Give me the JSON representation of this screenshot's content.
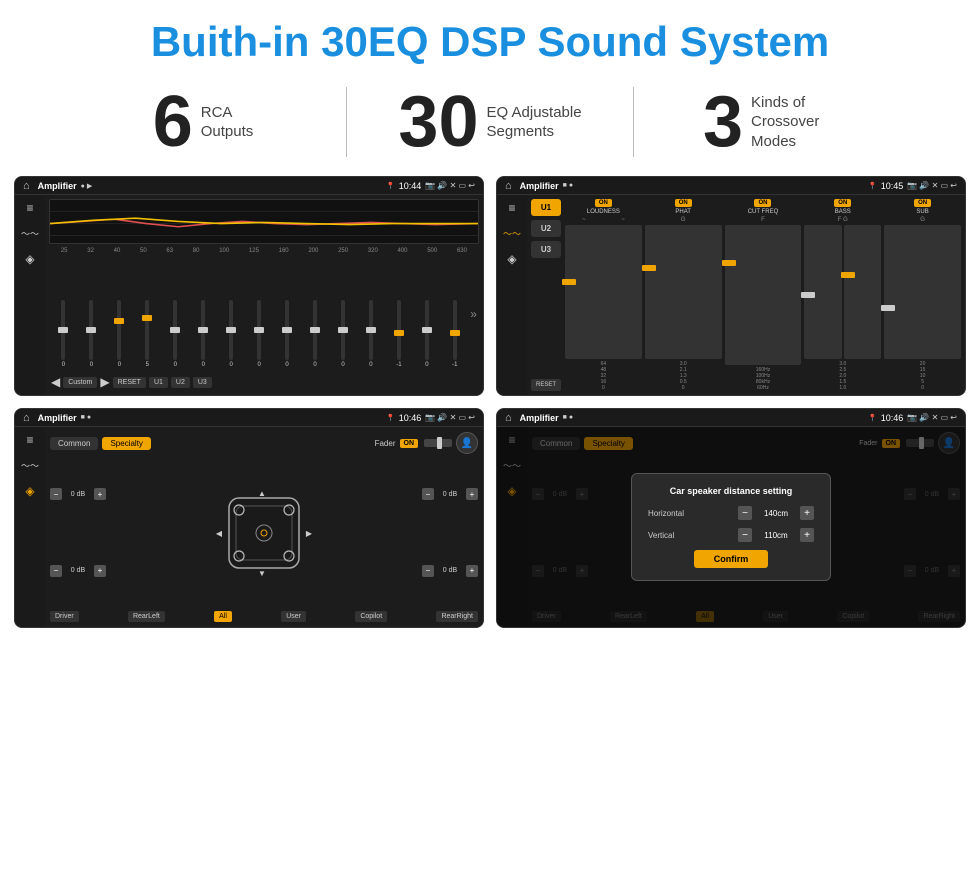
{
  "header": {
    "title": "Buith-in 30EQ DSP Sound System"
  },
  "stats": [
    {
      "number": "6",
      "label": "RCA\nOutputs"
    },
    {
      "number": "30",
      "label": "EQ Adjustable\nSegments"
    },
    {
      "number": "3",
      "label": "Kinds of\nCrossover Modes"
    }
  ],
  "screen1": {
    "status_bar": {
      "title": "Amplifier",
      "time": "10:44"
    },
    "freq_labels": [
      "25",
      "32",
      "40",
      "50",
      "63",
      "80",
      "100",
      "125",
      "160",
      "200",
      "250",
      "320",
      "400",
      "500",
      "630"
    ],
    "slider_vals": [
      "0",
      "0",
      "0",
      "5",
      "0",
      "0",
      "0",
      "0",
      "0",
      "0",
      "0",
      "0",
      "-1",
      "0",
      "-1"
    ],
    "bottom_btns": [
      "Custom",
      "RESET",
      "U1",
      "U2",
      "U3"
    ]
  },
  "screen2": {
    "status_bar": {
      "title": "Amplifier",
      "time": "10:45"
    },
    "presets": [
      "U1",
      "U2",
      "U3"
    ],
    "channels": [
      {
        "label": "LOUDNESS",
        "on": true
      },
      {
        "label": "PHAT",
        "on": true
      },
      {
        "label": "CUT FREQ",
        "on": true
      },
      {
        "label": "BASS",
        "on": true
      },
      {
        "label": "SUB",
        "on": true
      }
    ],
    "reset": "RESET"
  },
  "screen3": {
    "status_bar": {
      "title": "Amplifier",
      "time": "10:46"
    },
    "tabs": [
      "Common",
      "Specialty"
    ],
    "fader_label": "Fader",
    "fader_on": "ON",
    "db_values": [
      "0 dB",
      "0 dB",
      "0 dB",
      "0 dB"
    ],
    "bottom_btns": [
      "Driver",
      "RearLeft",
      "All",
      "User",
      "Copilot",
      "RearRight"
    ]
  },
  "screen4": {
    "status_bar": {
      "title": "Amplifier",
      "time": "10:46"
    },
    "tabs": [
      "Common",
      "Specialty"
    ],
    "dialog": {
      "title": "Car speaker distance setting",
      "horizontal_label": "Horizontal",
      "horizontal_val": "140cm",
      "vertical_label": "Vertical",
      "vertical_val": "110cm",
      "confirm_label": "Confirm"
    },
    "db_values": [
      "0 dB",
      "0 dB"
    ],
    "bottom_btns": [
      "Driver",
      "RearLeft",
      "All",
      "User",
      "Copilot",
      "RearRight"
    ]
  },
  "icons": {
    "home": "⌂",
    "location": "📍",
    "volume": "🔊",
    "back": "↩",
    "eq_icon": "≡",
    "wave_icon": "〜",
    "speaker_icon": "◈",
    "user_icon": "👤",
    "minus": "−",
    "plus": "+"
  }
}
